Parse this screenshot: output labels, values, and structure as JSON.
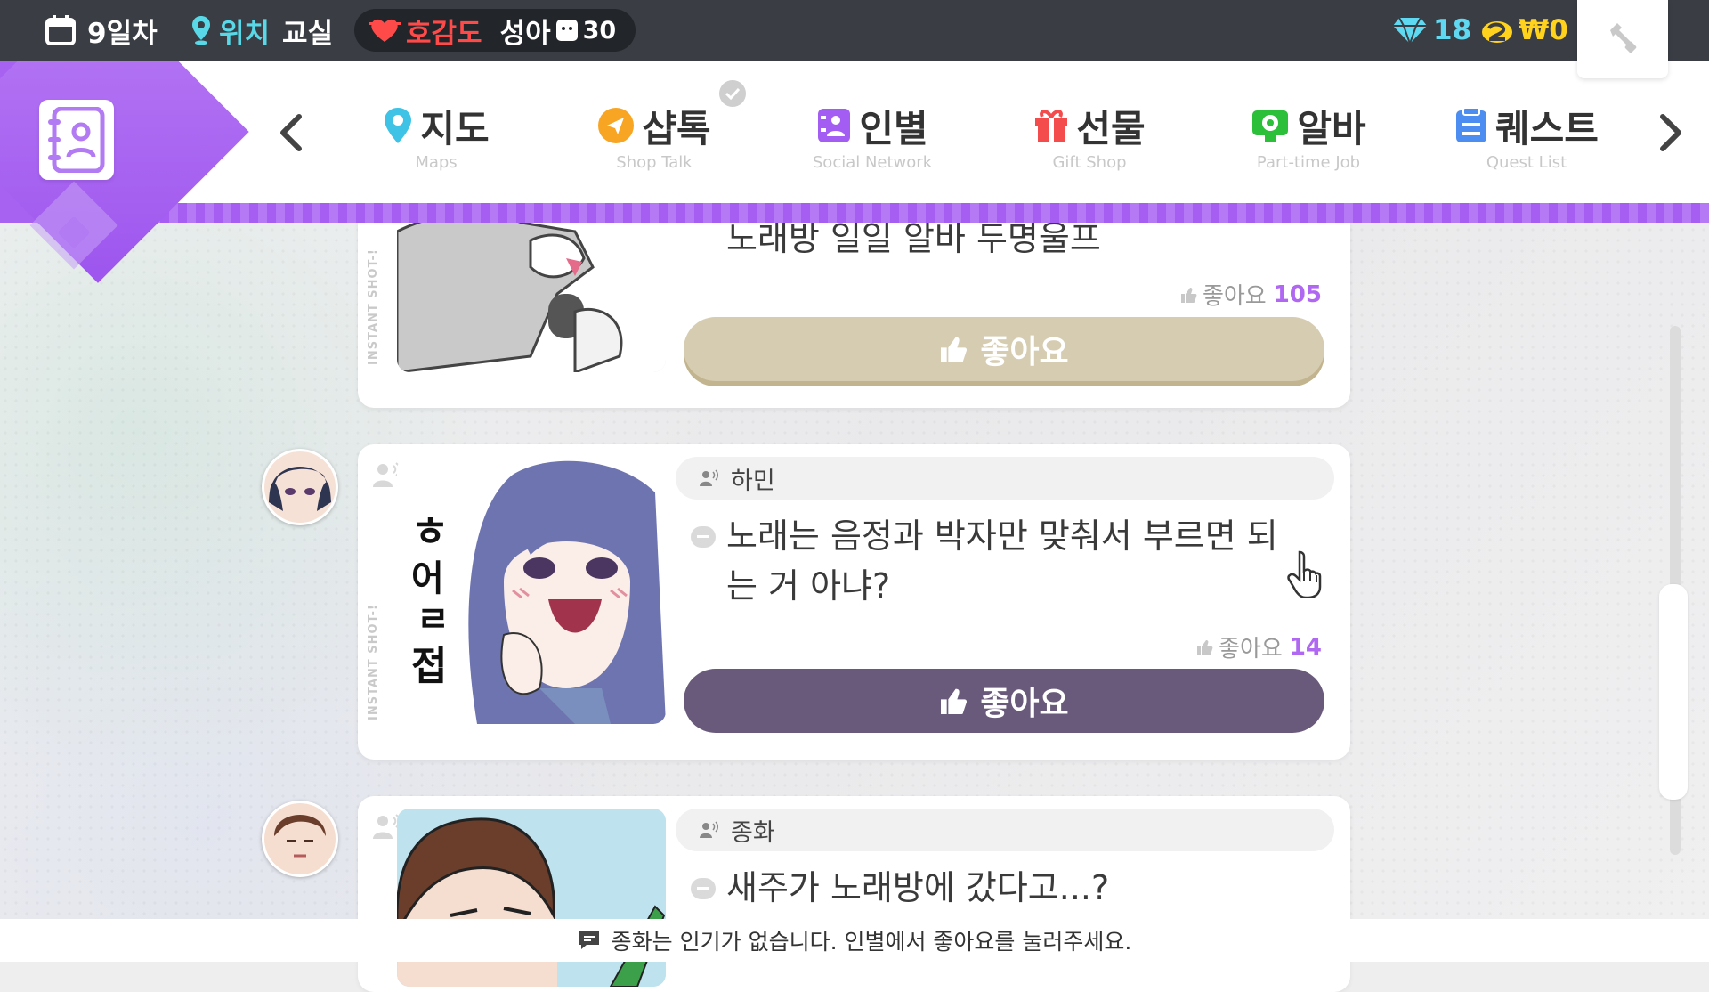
{
  "topbar": {
    "day": "9일차",
    "location_label": "위치",
    "location_value": "교실",
    "affinity_label": "호감도",
    "affinity_name": "성아",
    "affinity_value": "30",
    "gems": "18",
    "money": "₩0",
    "icons": [
      "calendar-icon",
      "location-pin-icon",
      "heart-icon",
      "face-icon",
      "diamond-icon",
      "coin-icon",
      "wrench-icon"
    ]
  },
  "nav": {
    "items": [
      {
        "label": "지도",
        "sub": "Maps",
        "icon": "map-pin-icon",
        "color": "#3ec3e6"
      },
      {
        "label": "샵톡",
        "sub": "Shop Talk",
        "icon": "chat-icon",
        "color": "#f7a523"
      },
      {
        "label": "인별",
        "sub": "Social Network",
        "icon": "contacts-icon",
        "color": "#a45df2"
      },
      {
        "label": "선물",
        "sub": "Gift Shop",
        "icon": "gift-icon",
        "color": "#f44c4c"
      },
      {
        "label": "알바",
        "sub": "Part-time Job",
        "icon": "job-icon",
        "color": "#2bbf3a"
      },
      {
        "label": "퀘스트",
        "sub": "Quest List",
        "icon": "quest-icon",
        "color": "#4b8df0"
      }
    ]
  },
  "feed": {
    "vertical_label": "INSTANT SHOT-!",
    "like_word": "좋아요",
    "posts": [
      {
        "author": "",
        "text": "노래방 일일 알바 두명울프",
        "likes": "105",
        "button": "좋아요"
      },
      {
        "author": "하민",
        "text": "노래는 음정과 박자만 맞춰서 부르면 되는 거 아냐?",
        "likes": "14",
        "button": "좋아요",
        "image_caption": "허ㄹ접"
      },
      {
        "author": "종화",
        "text": "새주가 노래방에 갔다고...?"
      }
    ]
  },
  "toast": {
    "text": "종화는 인기가 없습니다. 인별에서 좋아요를 눌러주세요."
  },
  "colors": {
    "accent": "#a55df2",
    "topbar": "#3a3e44",
    "like_count": "#b067f2",
    "button_purple": "#695a7b",
    "button_tan": "#d6ccb1"
  }
}
